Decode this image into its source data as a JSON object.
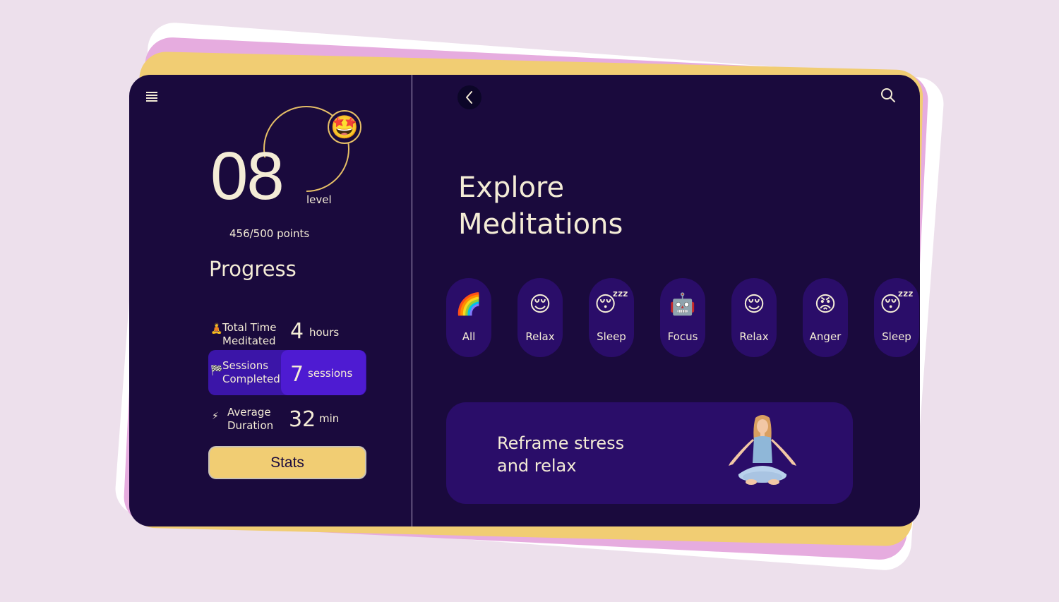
{
  "theme": {
    "background": "#ede0ec",
    "card": "#1a0a3d",
    "accent_yellow": "#f1cd73",
    "accent_pink": "#e6acdf",
    "chip_bg": "#2a0d69",
    "highlight": "#4e1bd2",
    "text": "#f4ecd6"
  },
  "sidebar": {
    "menu_icon": "hamburger-menu-icon",
    "level": {
      "number": "08",
      "label": "level",
      "emoji": "🤩",
      "points_text": "456/500 points",
      "points_current": 456,
      "points_max": 500
    },
    "progress_title": "Progress",
    "stats": [
      {
        "icon": "🧘",
        "label_line1": "Total Time",
        "label_line2": "Meditated",
        "value": "4",
        "unit": "hours",
        "highlighted": false
      },
      {
        "icon": "🏁",
        "label_line1": "Sessions",
        "label_line2": "Completed",
        "value": "7",
        "unit": "sessions",
        "highlighted": true
      },
      {
        "icon": "⚡",
        "label_line1": "Average",
        "label_line2": "Duration",
        "value": "32",
        "unit": "min",
        "highlighted": false
      }
    ],
    "stats_button": "Stats"
  },
  "main": {
    "back_icon": "chevron-left-icon",
    "search_icon": "search-icon",
    "title_line1": "Explore",
    "title_line2": "Meditations",
    "categories": [
      {
        "emoji": "🌈",
        "label": "All"
      },
      {
        "emoji": "😌",
        "label": "Relax"
      },
      {
        "emoji": "😴",
        "label": "Sleep"
      },
      {
        "emoji": "🤖",
        "label": "Focus"
      },
      {
        "emoji": "😌",
        "label": "Relax"
      },
      {
        "emoji": "😡",
        "label": "Anger"
      },
      {
        "emoji": "😴",
        "label": "Sleep"
      }
    ],
    "banner": {
      "text_line1": "Reframe stress",
      "text_line2": "and relax",
      "illustration": "meditating-woman-illustration"
    }
  }
}
